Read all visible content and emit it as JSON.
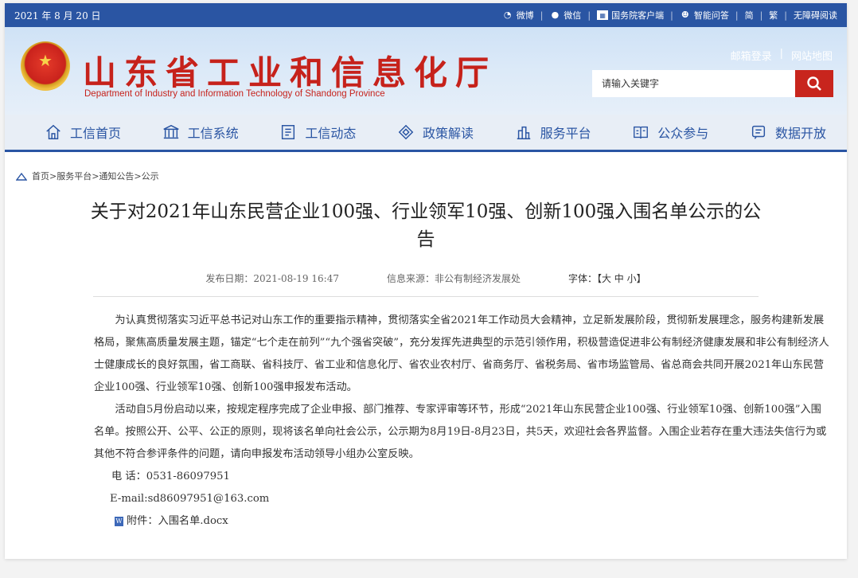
{
  "topbar": {
    "date": "2021 年 8 月 20 日",
    "links": [
      "微博",
      "微信",
      "国务院客户端",
      "智能问答",
      "简",
      "繁",
      "无障碍阅读"
    ]
  },
  "header": {
    "title": "山东省工业和信息化厅",
    "subtitle": "Department of Industry and Information Technology of Shandong Province",
    "links": [
      "邮箱登录",
      "|",
      "网站地图"
    ],
    "search_placeholder": "请输入关键字"
  },
  "nav": [
    {
      "label": "工信首页",
      "icon": "home-icon"
    },
    {
      "label": "工信系统",
      "icon": "building-icon"
    },
    {
      "label": "工信动态",
      "icon": "news-icon"
    },
    {
      "label": "政策解读",
      "icon": "policy-icon"
    },
    {
      "label": "服务平台",
      "icon": "platform-icon"
    },
    {
      "label": "公众参与",
      "icon": "participate-icon"
    },
    {
      "label": "数据开放",
      "icon": "data-icon"
    }
  ],
  "breadcrumb": "首页>服务平台>通知公告>公示",
  "article": {
    "title": "关于对2021年山东民营企业100强、行业领军10强、创新100强入围名单公示的公告",
    "publish_date": "发布日期：2021-08-19 16:47",
    "source": "信息来源：非公有制经济发展处",
    "font_size": "字体：【大 中 小】",
    "paragraphs": [
      "为认真贯彻落实习近平总书记对山东工作的重要指示精神，贯彻落实全省2021年工作动员大会精神，立足新发展阶段，贯彻新发展理念，服务构建新发展格局，聚焦高质量发展主题，锚定“七个走在前列”“九个强省突破”，充分发挥先进典型的示范引领作用，积极营造促进非公有制经济健康发展和非公有制经济人士健康成长的良好氛围，省工商联、省科技厅、省工业和信息化厅、省农业农村厅、省商务厅、省税务局、省市场监管局、省总商会共同开展2021年山东民营企业100强、行业领军10强、创新100强申报发布活动。",
      "活动自5月份启动以来，按规定程序完成了企业申报、部门推荐、专家评审等环节，形成“2021年山东民营企业100强、行业领军10强、创新100强”入围名单。按照公开、公平、公正的原则，现将该名单向社会公示，公示期为8月19日-8月23日，共5天，欢迎社会各界监督。入围企业若存在重大违法失信行为或其他不符合参评条件的问题，请向申报发布活动领导小组办公室反映。"
    ],
    "phone": "电 话：0531-86097951",
    "email": "E-mail:sd86097951@163.com",
    "attachment": "附件：入围名单.docx"
  }
}
